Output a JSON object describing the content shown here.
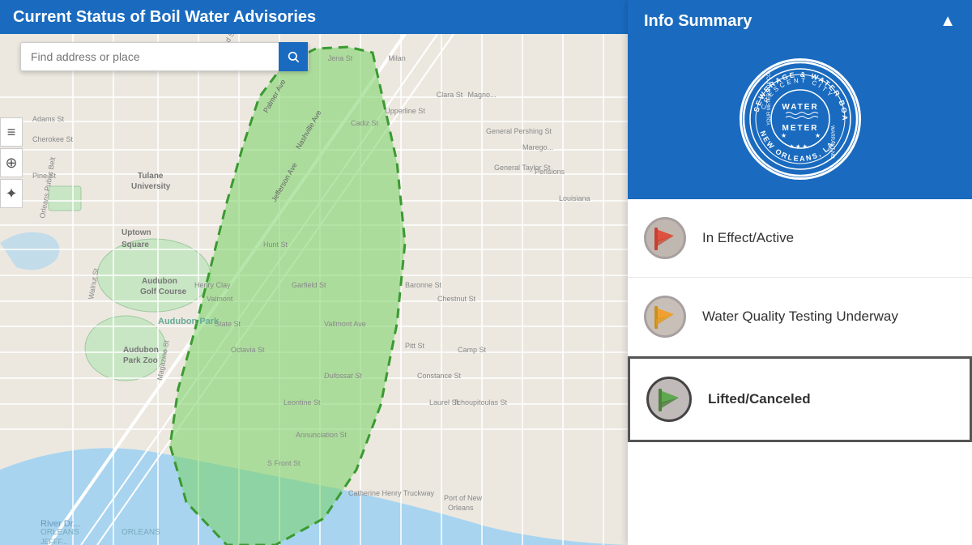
{
  "header": {
    "title": "Current Status of Boil Water Advisories",
    "icon": "person-icon"
  },
  "search": {
    "placeholder": "Find address or place"
  },
  "info_panel": {
    "title": "Info Summary",
    "collapse_icon": "chevron-up-icon",
    "logo_alt": "Sewerage & Water Board Crescent City Water Meter New Orleans LA",
    "legend": [
      {
        "id": "in-effect",
        "label": "In Effect/Active",
        "icon_color_top": "#e05040",
        "icon_color_bottom": "#c84030",
        "bold": false
      },
      {
        "id": "testing-underway",
        "label": "Water Quality Testing Underway",
        "icon_color_top": "#f0a030",
        "icon_color_bottom": "#e09020",
        "bold": false
      },
      {
        "id": "lifted",
        "label": "Lifted/Canceled",
        "icon_color_top": "#60a850",
        "icon_color_bottom": "#508040",
        "bold": true
      }
    ]
  }
}
